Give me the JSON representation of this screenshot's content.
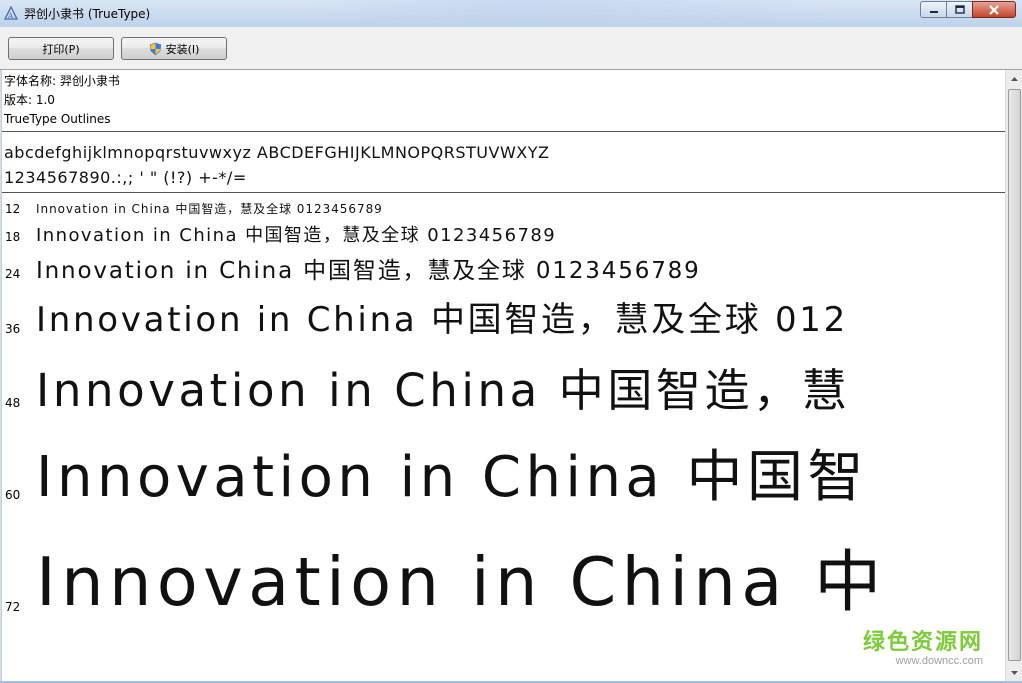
{
  "window": {
    "title": "羿创小隶书 (TrueType)"
  },
  "toolbar": {
    "print_label": "打印(P)",
    "install_label": "安装(I)"
  },
  "info": {
    "font_name": "字体名称: 羿创小隶书",
    "version": "版本: 1.0",
    "outline": "TrueType Outlines"
  },
  "charset": {
    "letters": "abcdefghijklmnopqrstuvwxyz ABCDEFGHIJKLMNOPQRSTUVWXYZ",
    "digits": "1234567890.:,; ' \" (!?) +-*/="
  },
  "samples": [
    {
      "size": "12",
      "text": "Innovation in China 中国智造，慧及全球 0123456789"
    },
    {
      "size": "18",
      "text": "Innovation in China 中国智造，慧及全球 0123456789"
    },
    {
      "size": "24",
      "text": "Innovation in China 中国智造，慧及全球 0123456789"
    },
    {
      "size": "36",
      "text": "Innovation in China 中国智造，慧及全球 012"
    },
    {
      "size": "48",
      "text": "Innovation in China 中国智造，慧"
    },
    {
      "size": "60",
      "text": "Innovation in China 中国智"
    },
    {
      "size": "72",
      "text": "Innovation in China 中"
    }
  ],
  "watermark": {
    "main": "绿色资源网",
    "sub": "www.downcc.com"
  },
  "colors": {
    "watermark_green": "#7ecb3a"
  }
}
